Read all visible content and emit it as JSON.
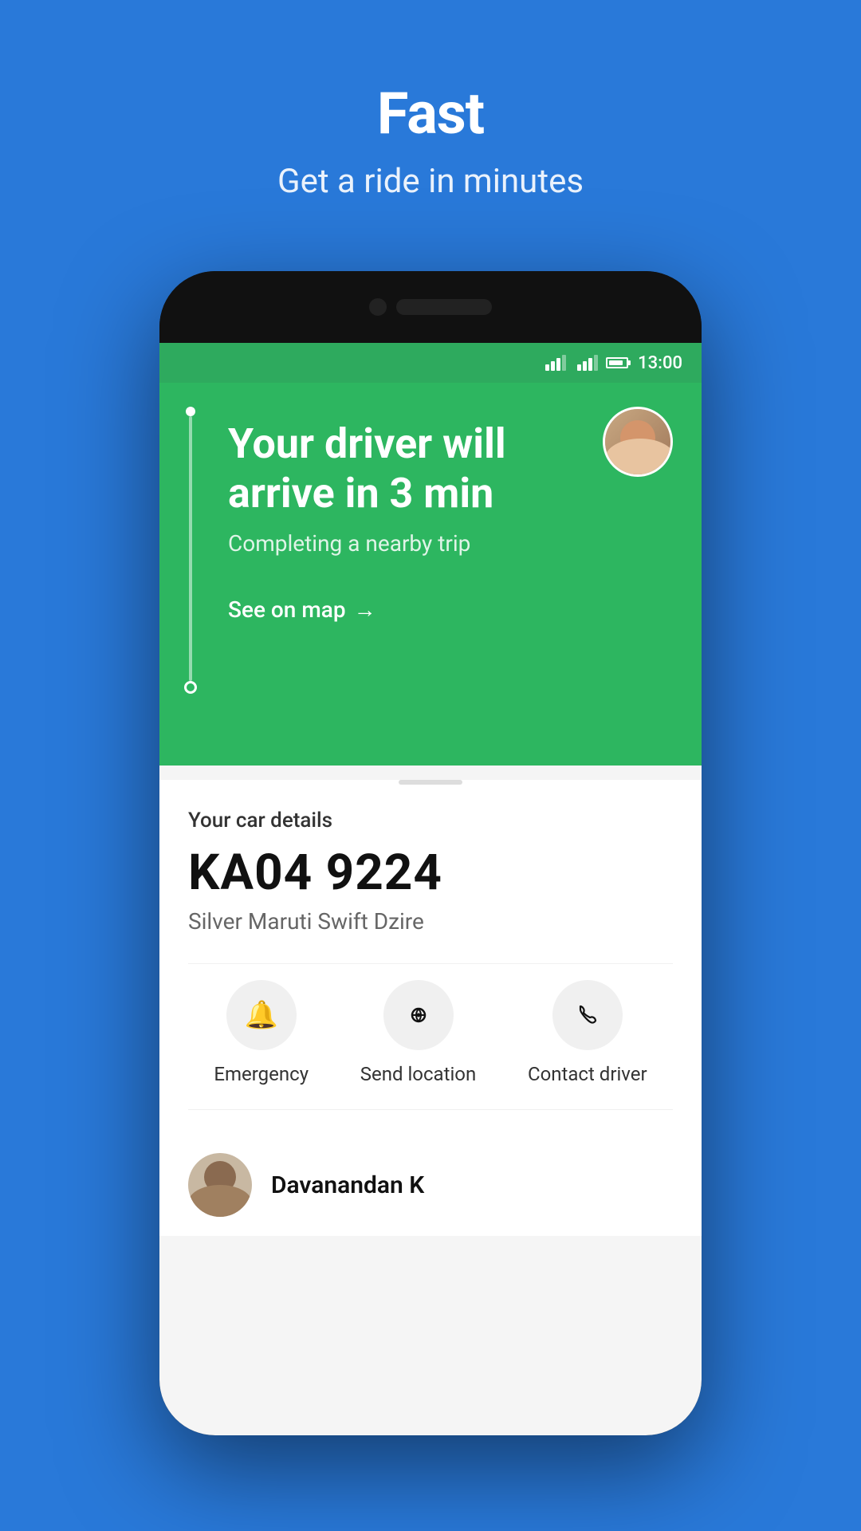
{
  "hero": {
    "title": "Fast",
    "subtitle": "Get a ride in minutes"
  },
  "statusBar": {
    "time": "13:00"
  },
  "rideCard": {
    "mainText": "Your driver will arrive in 3 min",
    "subText": "Completing a nearby trip",
    "seeOnMapLabel": "See on map",
    "arrowSymbol": "→"
  },
  "carDetails": {
    "sectionLabel": "Your car details",
    "plate": "KA04 9224",
    "model": "Silver Maruti Swift Dzire"
  },
  "actions": [
    {
      "id": "emergency",
      "icon": "🔔",
      "label": "Emergency"
    },
    {
      "id": "send-location",
      "icon": "📡",
      "label": "Send location"
    },
    {
      "id": "contact-driver",
      "icon": "📞",
      "label": "Contact driver"
    }
  ],
  "driver": {
    "name": "Davanandan K"
  }
}
